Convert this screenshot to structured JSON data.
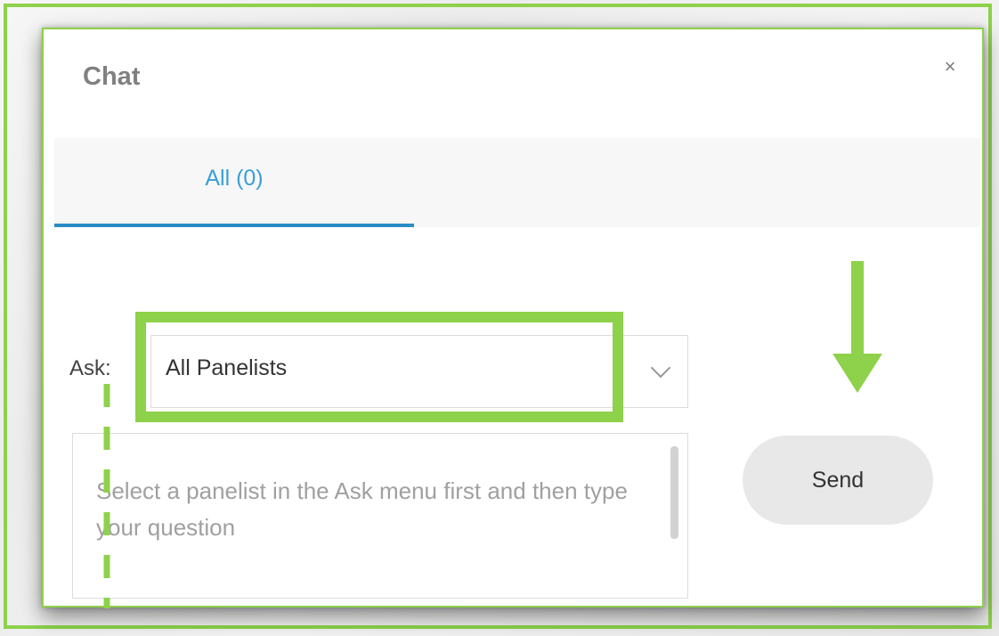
{
  "chat": {
    "title": "Chat",
    "close_glyph": "×"
  },
  "tabs": [
    {
      "label": "All (0)",
      "active": true
    }
  ],
  "ask": {
    "label": "Ask:",
    "selected": "All Panelists"
  },
  "question": {
    "placeholder": "Select a panelist in the Ask menu first and then type your question"
  },
  "send": {
    "label": "Send"
  },
  "colors": {
    "highlight": "#8ed14a",
    "tab_accent": "#3a9fd6"
  },
  "icons": {
    "close": "close-icon",
    "dropdown": "chevron-down-icon",
    "annotation_arrow": "arrow-down-icon"
  }
}
